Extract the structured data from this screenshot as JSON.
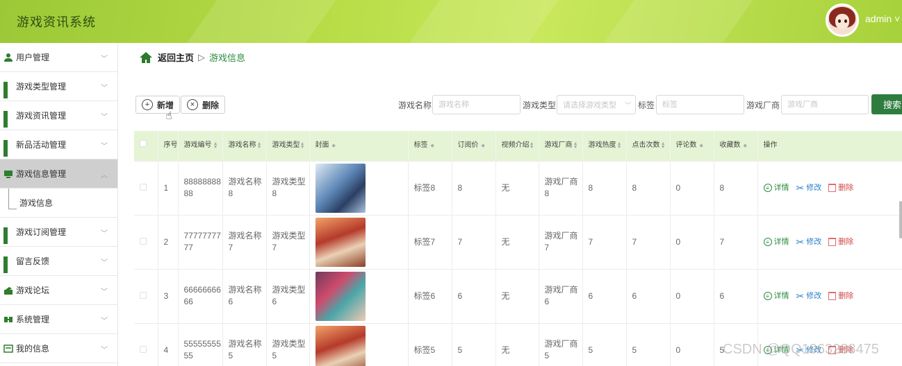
{
  "header": {
    "title": "游戏资讯系统",
    "user": "admin ˅"
  },
  "sidebar": {
    "items": [
      {
        "label": "用户管理",
        "icon": "user-icon"
      },
      {
        "label": "游戏类型管理",
        "icon": "grid-icon"
      },
      {
        "label": "游戏资讯管理",
        "icon": "grid-icon"
      },
      {
        "label": "新品活动管理",
        "icon": "grid-icon"
      },
      {
        "label": "游戏信息管理",
        "icon": "monitor-icon",
        "active": true
      },
      {
        "label": "游戏信息",
        "sub": true
      },
      {
        "label": "游戏订阅管理",
        "icon": "grid-icon"
      },
      {
        "label": "留言反馈",
        "icon": "grid-icon"
      },
      {
        "label": "游戏论坛",
        "icon": "forum-icon"
      },
      {
        "label": "系统管理",
        "icon": "system-icon"
      },
      {
        "label": "我的信息",
        "icon": "profile-icon"
      }
    ]
  },
  "breadcrumb": {
    "home": "返回主页",
    "sep": "▷",
    "current": "游戏信息"
  },
  "toolbar": {
    "add_label": "新增",
    "delete_label": "删除"
  },
  "filters": {
    "name_label": "游戏名称",
    "name_placeholder": "游戏名称",
    "type_label": "游戏类型",
    "type_placeholder": "请选择游戏类型",
    "tag_label": "标签",
    "tag_placeholder": "标签",
    "maker_label": "游戏厂商",
    "maker_placeholder": "游戏厂商",
    "search_label": "搜索"
  },
  "table": {
    "headers": [
      "序号",
      "游戏编号",
      "游戏名称",
      "游戏类型",
      "封面",
      "标签",
      "订阅价",
      "视频介绍",
      "游戏厂商",
      "游戏热度",
      "点击次数",
      "评论数",
      "收藏数",
      "操作"
    ],
    "ops": {
      "detail": "详情",
      "edit": "修改",
      "delete": "删除"
    },
    "rows": [
      {
        "idx": "1",
        "code": "8888888888",
        "name": "游戏名称8",
        "type": "游戏类型8",
        "cover": "a",
        "tag": "标签8",
        "price": "8",
        "video": "无",
        "maker": "游戏厂商8",
        "heat": "8",
        "clicks": "8",
        "comments": "0",
        "favs": "8"
      },
      {
        "idx": "2",
        "code": "7777777777",
        "name": "游戏名称7",
        "type": "游戏类型7",
        "cover": "b",
        "tag": "标签7",
        "price": "7",
        "video": "无",
        "maker": "游戏厂商7",
        "heat": "7",
        "clicks": "7",
        "comments": "0",
        "favs": "7"
      },
      {
        "idx": "3",
        "code": "6666666666",
        "name": "游戏名称6",
        "type": "游戏类型6",
        "cover": "c",
        "tag": "标签6",
        "price": "6",
        "video": "无",
        "maker": "游戏厂商6",
        "heat": "6",
        "clicks": "6",
        "comments": "0",
        "favs": "6"
      },
      {
        "idx": "4",
        "code": "5555555555",
        "name": "游戏名称5",
        "type": "游戏类型5",
        "cover": "b",
        "tag": "标签5",
        "price": "5",
        "video": "无",
        "maker": "游戏厂商5",
        "heat": "5",
        "clicks": "5",
        "comments": "0",
        "favs": "5"
      }
    ]
  },
  "watermark": "CSDN @QQ1963288475",
  "colors": {
    "header_green": "#b6dc45",
    "accent": "#2f7d3e",
    "table_head": "#e4f4d4"
  }
}
